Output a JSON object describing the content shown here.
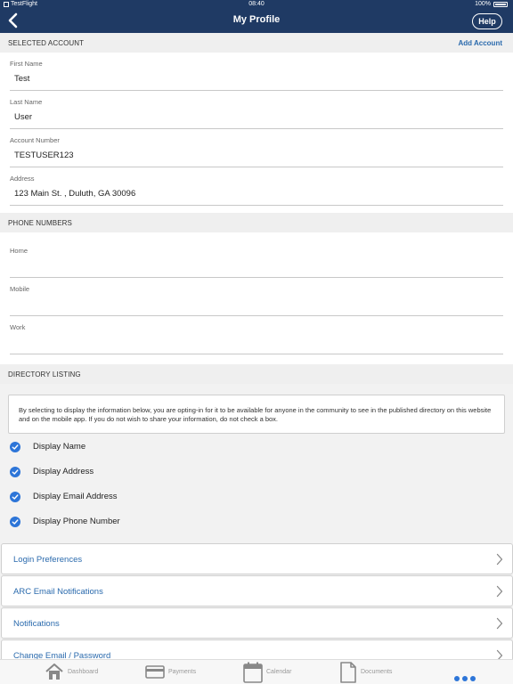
{
  "status_bar": {
    "carrier": "TestFlight",
    "time": "08:40",
    "battery": "100%"
  },
  "nav": {
    "title": "My Profile",
    "help_label": "Help"
  },
  "selected_account": {
    "header": "SELECTED ACCOUNT",
    "action": "Add Account",
    "fields": [
      {
        "label": "First Name",
        "value": "Test"
      },
      {
        "label": "Last Name",
        "value": "User"
      },
      {
        "label": "Account Number",
        "value": "TESTUSER123"
      },
      {
        "label": "Address",
        "value": "123  Main St. , Duluth, GA 30096"
      }
    ]
  },
  "phone_numbers": {
    "header": "PHONE NUMBERS",
    "fields": [
      {
        "label": "Home",
        "value": ""
      },
      {
        "label": "Mobile",
        "value": ""
      },
      {
        "label": "Work",
        "value": ""
      }
    ]
  },
  "directory_listing": {
    "header": "DIRECTORY LISTING",
    "notice": "By selecting to display the information below, you are opting-in for it to be available for anyone in the community to see in the published directory on this website and on the mobile app. If you do not wish to share your information, do not check a box.",
    "options": [
      {
        "label": "Display Name",
        "checked": true
      },
      {
        "label": "Display Address",
        "checked": true
      },
      {
        "label": "Display Email Address",
        "checked": true
      },
      {
        "label": "Display Phone Number",
        "checked": true
      }
    ]
  },
  "menu": [
    {
      "label": "Login Preferences"
    },
    {
      "label": "ARC Email Notifications"
    },
    {
      "label": "Notifications"
    },
    {
      "label": "Change Email / Password"
    }
  ],
  "tabs": [
    {
      "label": "Dashboard",
      "icon": "home-icon"
    },
    {
      "label": "Payments",
      "icon": "credit-card-icon"
    },
    {
      "label": "Calendar",
      "icon": "calendar-icon"
    },
    {
      "label": "Documents",
      "icon": "document-icon"
    },
    {
      "label": "",
      "icon": "more-icon"
    }
  ],
  "colors": {
    "nav_bg": "#1f3a64",
    "accent": "#2a6aad",
    "check": "#2d75d8"
  }
}
